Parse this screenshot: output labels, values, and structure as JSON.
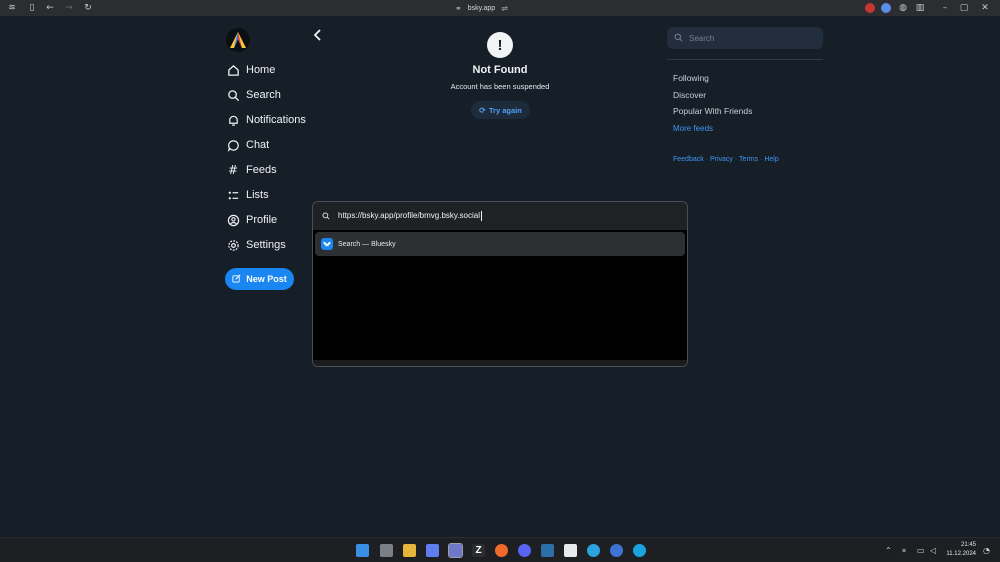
{
  "browser": {
    "url_display": "bsky.app"
  },
  "sidebar": {
    "items": [
      {
        "label": "Home",
        "icon": "home-icon"
      },
      {
        "label": "Search",
        "icon": "search-icon"
      },
      {
        "label": "Notifications",
        "icon": "bell-icon"
      },
      {
        "label": "Chat",
        "icon": "chat-icon"
      },
      {
        "label": "Feeds",
        "icon": "hash-icon"
      },
      {
        "label": "Lists",
        "icon": "list-icon"
      },
      {
        "label": "Profile",
        "icon": "user-icon"
      },
      {
        "label": "Settings",
        "icon": "gear-icon"
      }
    ],
    "new_post_label": "New Post"
  },
  "main": {
    "error_icon": "!",
    "title": "Not Found",
    "subtitle": "Account has been suspended",
    "try_again_label": "Try again"
  },
  "right": {
    "search_placeholder": "Search",
    "feeds": [
      "Following",
      "Discover",
      "Popular With Friends"
    ],
    "more_feeds_label": "More feeds",
    "footer": [
      "Feedback",
      "Privacy",
      "Terms",
      "Help"
    ]
  },
  "launcher": {
    "query": "https://bsky.app/profile/bmvg.bsky.social",
    "suggestion": "Search — Bluesky"
  },
  "taskbar": {
    "time": "21:45",
    "date": "11.12.2024"
  },
  "colors": {
    "accent": "#1a86f2",
    "link": "#3f97f2",
    "background": "#161e27"
  }
}
